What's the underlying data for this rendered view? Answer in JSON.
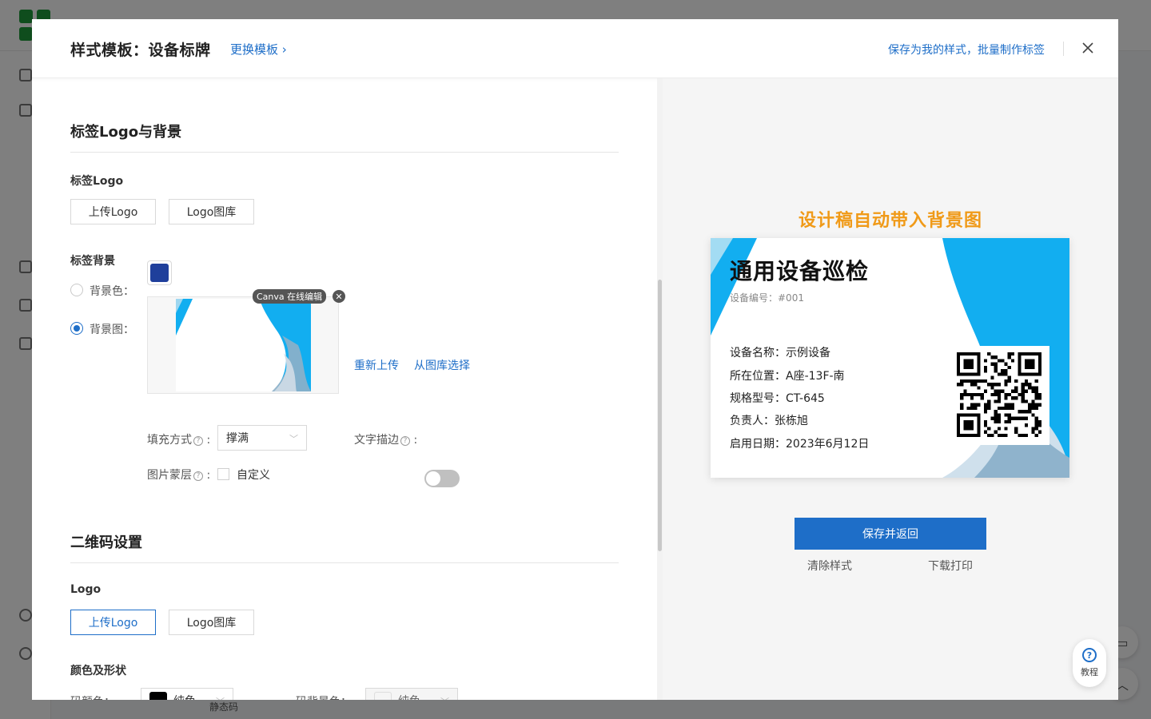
{
  "modal": {
    "title": "样式模板：设备标牌",
    "switch_template": "更换模板 ›",
    "save_as_mine": "保存为我的样式，批量制作标签",
    "close": "X"
  },
  "logo_bg_section": {
    "title": "标签Logo与背景",
    "label_logo": {
      "title": "标签Logo",
      "upload_button": "上传Logo",
      "library_button": "Logo图库"
    },
    "label_bg": {
      "title": "标签背景",
      "bg_color_label": "背景色：",
      "bg_color_value": "#1f3f9b",
      "bg_image_label": "背景图：",
      "canva_tag": "Canva 在线编辑",
      "reupload_link": "重新上传",
      "library_link": "从图库选择",
      "fill_mode_label": "填充方式",
      "fill_mode_value": "撑满",
      "text_stroke_label": "文字描边",
      "image_mask_label": "图片蒙层",
      "custom_label": "自定义"
    }
  },
  "qr_section": {
    "title": "二维码设置",
    "logo": {
      "title": "Logo",
      "upload_button": "上传Logo",
      "library_button": "Logo图库"
    },
    "color_shape": {
      "title": "颜色及形状",
      "code_color_label": "码颜色：",
      "code_color_value": "纯色",
      "code_color_hex": "#000000",
      "code_bg_label": "码背景色：",
      "code_bg_value": "纯色",
      "code_bg_hex": "#f5f5f5"
    }
  },
  "preview": {
    "caption": "设计稿自动带入背景图",
    "card": {
      "title": "通用设备巡检",
      "code": "设备编号：#001",
      "rows": [
        "设备名称：示例设备",
        "所在位置：A座-13F-南",
        "规格型号：CT-645",
        "负责人：张栋旭",
        "启用日期：2023年6月12日"
      ]
    },
    "save_return": "保存并返回",
    "clear_style": "清除样式",
    "download_print": "下载打印",
    "tutorial": "教程"
  },
  "background": {
    "bottom_text": "静态码"
  },
  "colors": {
    "accent": "#1e6ec8",
    "caption": "#f09a18",
    "card_gradient_blue": "#12aef0"
  }
}
